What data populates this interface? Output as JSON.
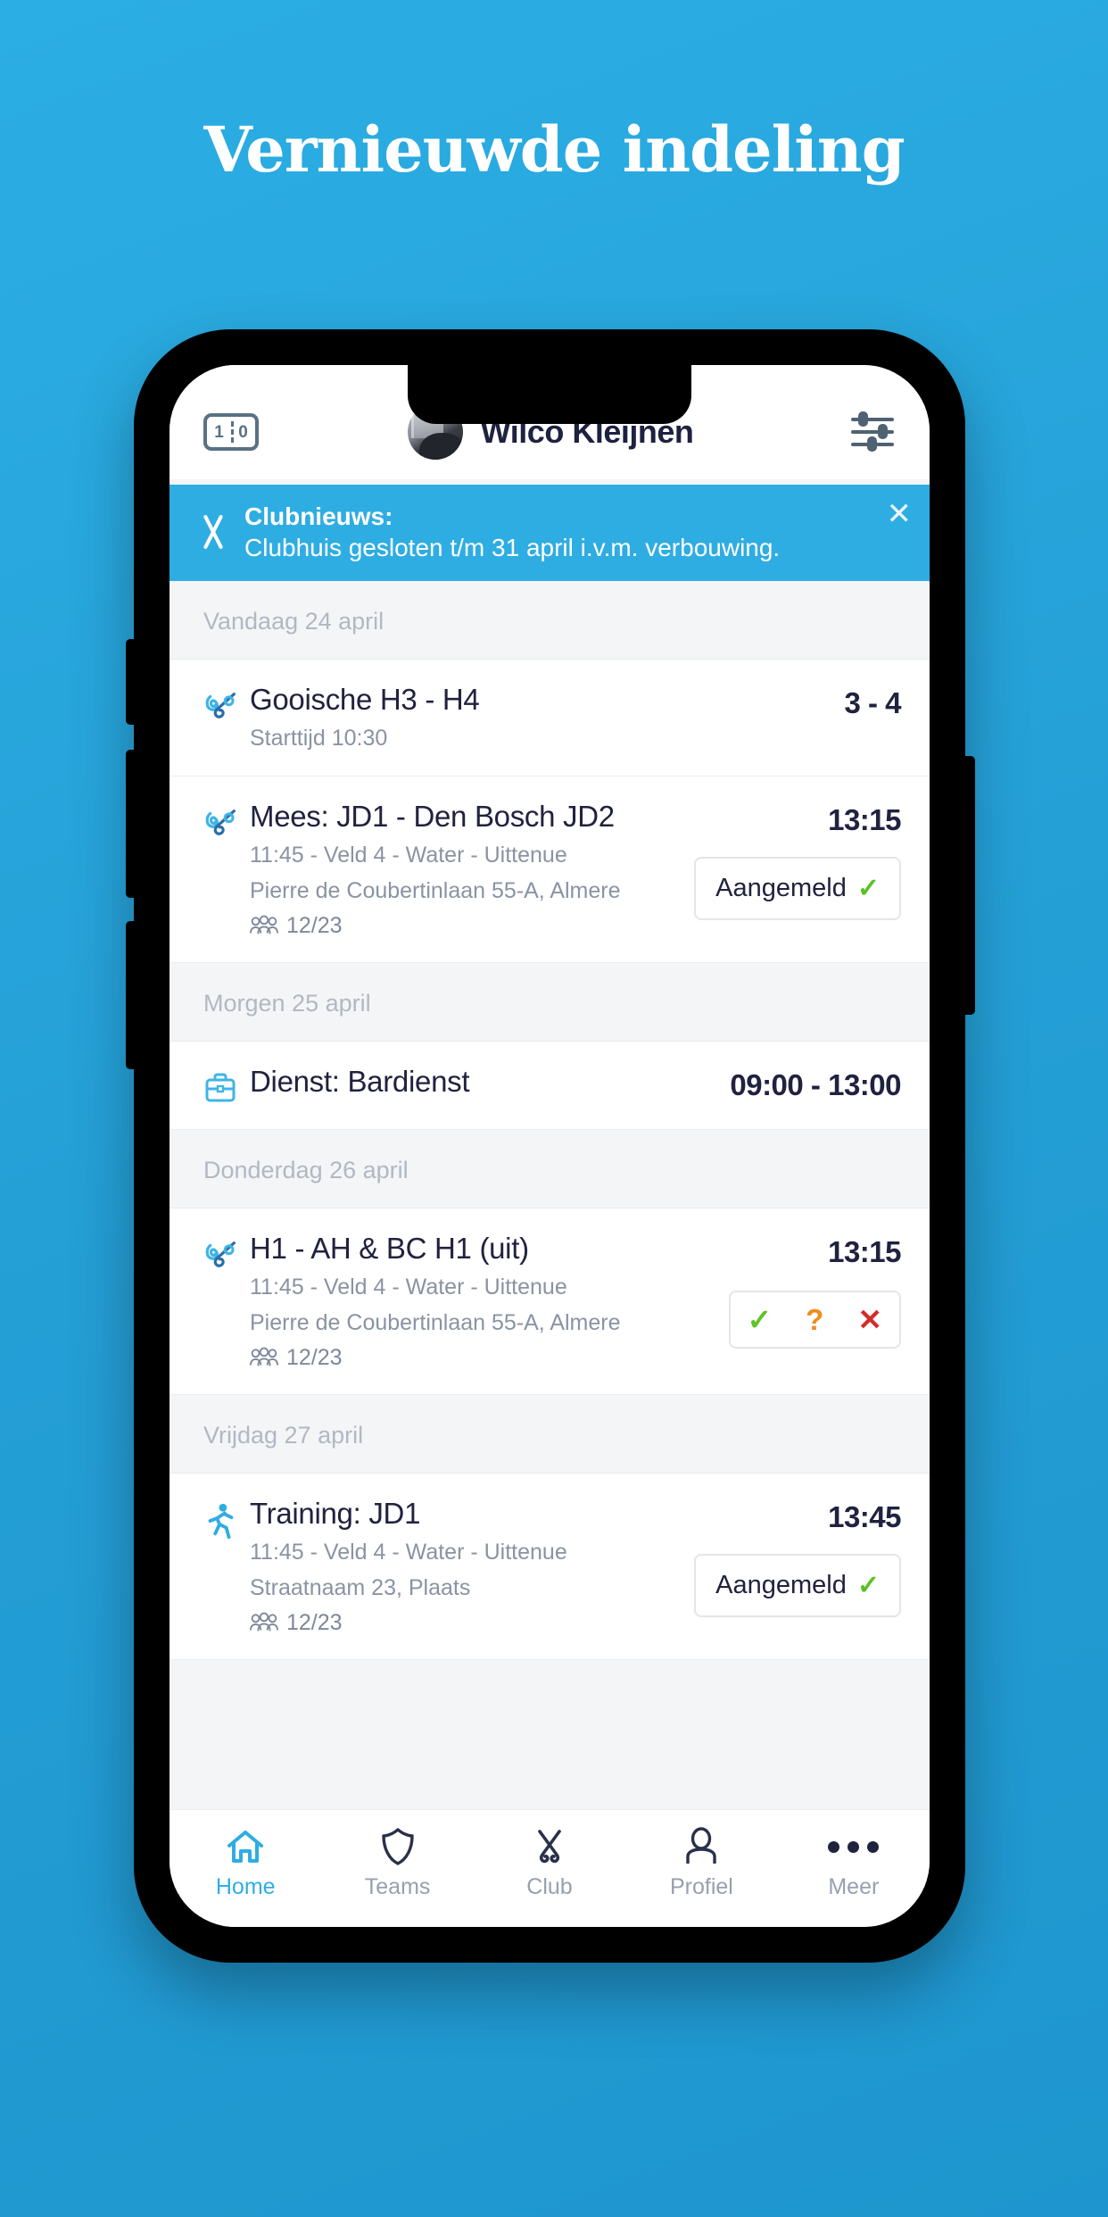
{
  "headline": "Vernieuwde indeling",
  "colors": {
    "background_blue": "#29ABE2",
    "accent_blue": "#2EADE3",
    "dark_navy": "#20223F",
    "muted_gray": "#8A93A3",
    "green": "#58C221",
    "orange": "#F08C1E",
    "red": "#D52B2B"
  },
  "header": {
    "score_icon": "scoreboard-icon",
    "score_left": "1",
    "score_right": "0",
    "avatar": "user-avatar",
    "user_name": "Wilco Kleijnen",
    "settings_icon": "sliders-icon"
  },
  "banner": {
    "icon": "hockey-sticks-icon",
    "title": "Clubnieuws:",
    "message": "Clubhuis gesloten t/m 31 april i.v.m. verbouwing.",
    "close_icon": "close-icon",
    "close_label": "✕"
  },
  "sections": [
    {
      "day_label": "Vandaag 24 april",
      "events": [
        {
          "icon": "hockey-sticks-icon",
          "title": "Gooische H3 - H4",
          "lines": [
            "Starttijd 10:30"
          ],
          "attendance": null,
          "right_value": "3 - 4",
          "action": null
        },
        {
          "icon": "hockey-sticks-icon",
          "title": "Mees: JD1 - Den Bosch JD2",
          "lines": [
            "11:45 - Veld 4 - Water - Uittenue",
            "Pierre de Coubertinlaan 55-A, Almere"
          ],
          "attendance": "12/23",
          "right_value": "13:15",
          "action": {
            "type": "signed-up",
            "label": "Aangemeld",
            "check": "✓"
          }
        }
      ]
    },
    {
      "day_label": "Morgen 25 april",
      "events": [
        {
          "icon": "briefcase-icon",
          "title": "Dienst: Bardienst",
          "lines": [],
          "attendance": null,
          "right_value": "09:00 - 13:00",
          "action": null
        }
      ]
    },
    {
      "day_label": "Donderdag 26 april",
      "events": [
        {
          "icon": "hockey-sticks-icon",
          "title": "H1 - AH & BC H1 (uit)",
          "lines": [
            "11:45 - Veld 4 - Water - Uittenue",
            "Pierre de Coubertinlaan 55-A, Almere"
          ],
          "attendance": "12/23",
          "right_value": "13:15",
          "action": {
            "type": "choice",
            "yes": "✓",
            "maybe": "?",
            "no": "✕"
          }
        }
      ]
    },
    {
      "day_label": "Vrijdag 27 april",
      "events": [
        {
          "icon": "running-icon",
          "title": "Training: JD1",
          "lines": [
            "11:45 - Veld 4 - Water - Uittenue",
            "Straatnaam 23, Plaats"
          ],
          "attendance": "12/23",
          "right_value": "13:45",
          "action": {
            "type": "signed-up",
            "label": "Aangemeld",
            "check": "✓"
          }
        }
      ]
    }
  ],
  "tabs": [
    {
      "label": "Home",
      "icon": "home-icon",
      "active": true
    },
    {
      "label": "Teams",
      "icon": "shield-icon",
      "active": false
    },
    {
      "label": "Club",
      "icon": "hockey-sticks-icon",
      "active": false
    },
    {
      "label": "Profiel",
      "icon": "person-icon",
      "active": false
    },
    {
      "label": "Meer",
      "icon": "ellipsis-icon",
      "active": false
    }
  ]
}
